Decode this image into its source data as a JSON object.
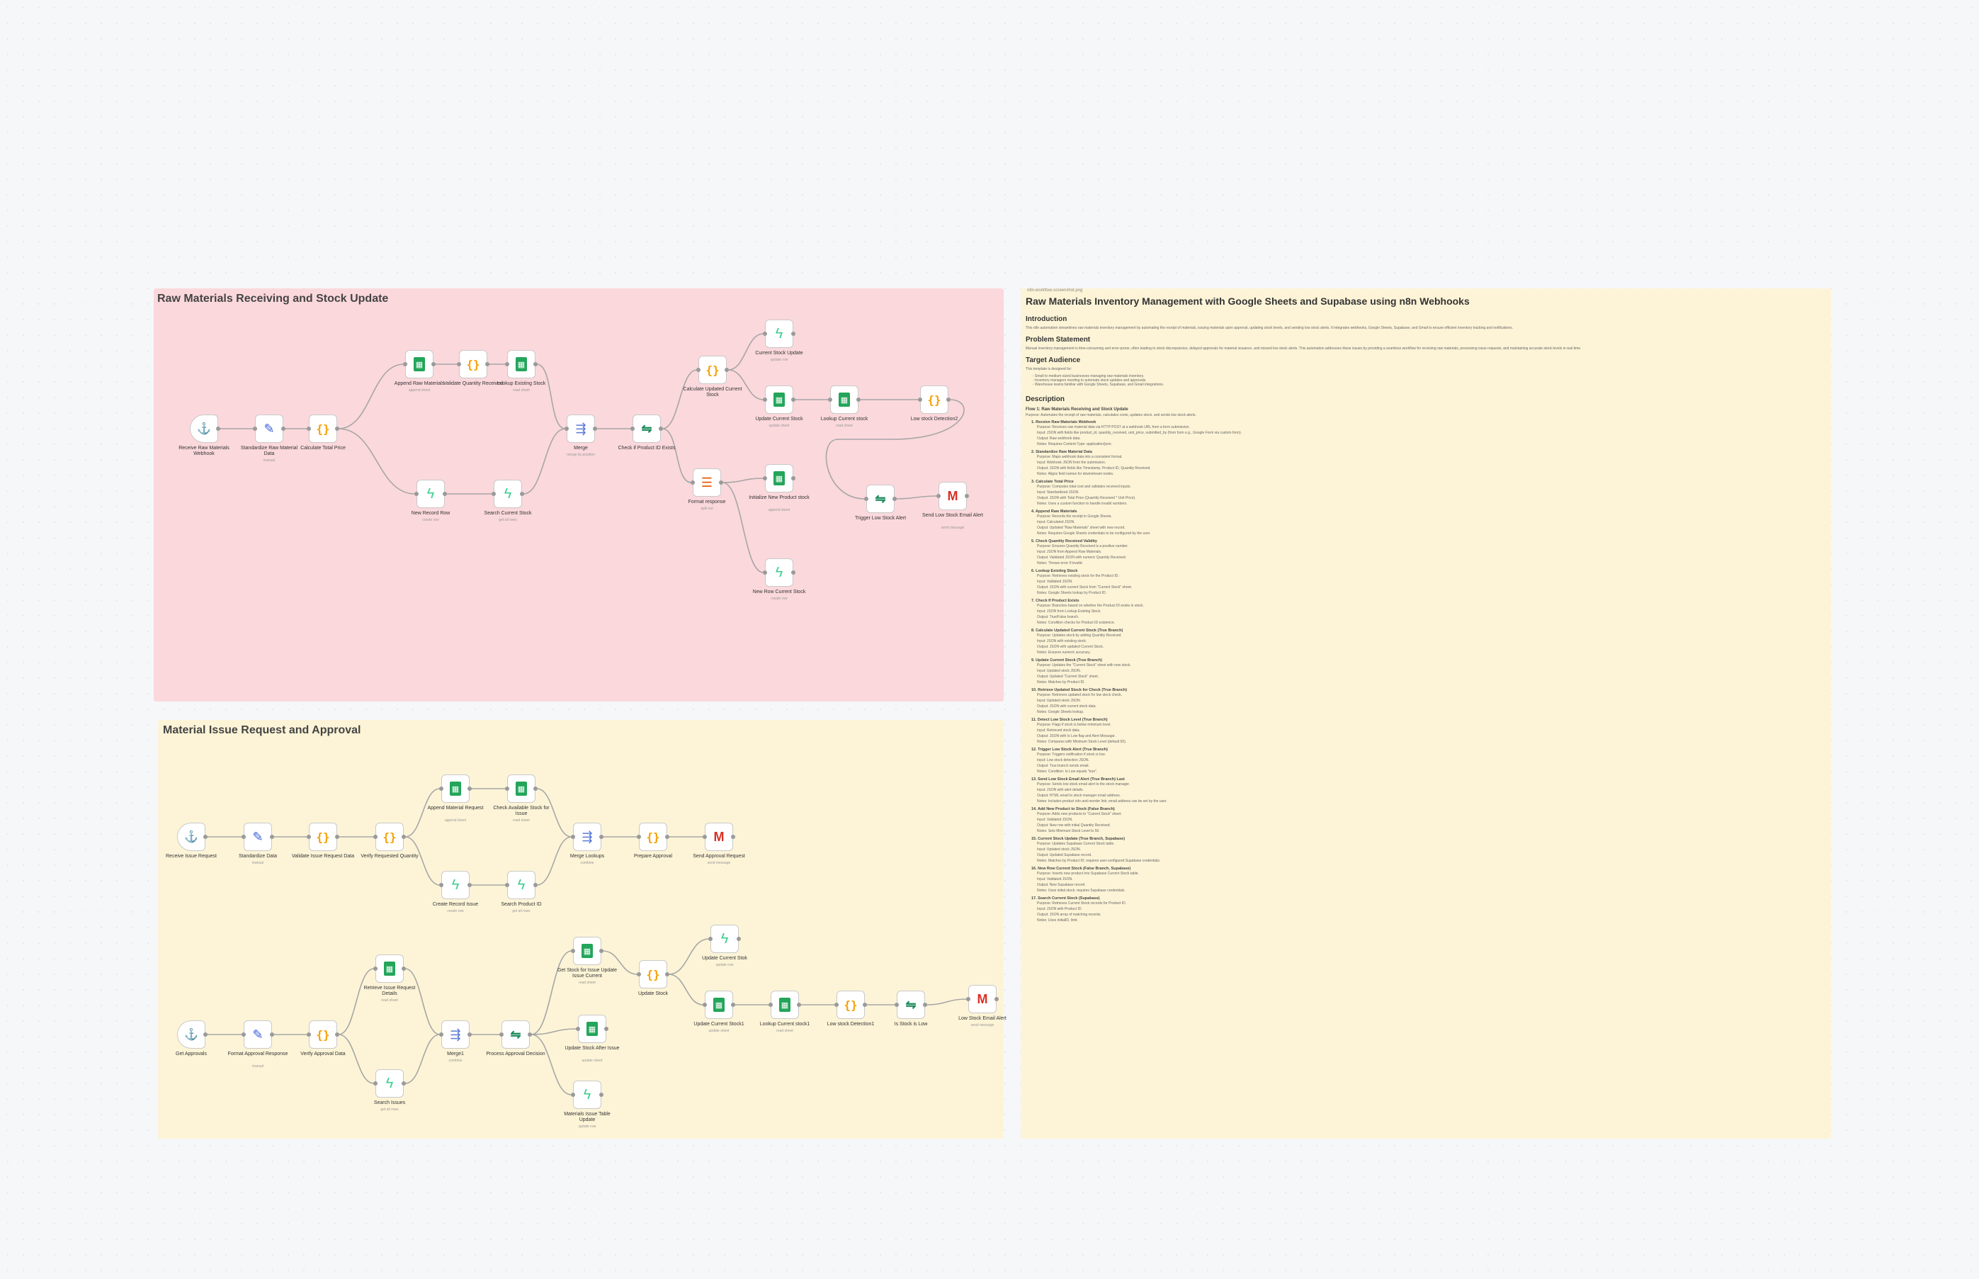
{
  "groups": {
    "receiving_title": "Raw Materials Receiving and Stock Update",
    "issue_title": "Material Issue Request and Approval"
  },
  "nodes": [
    {
      "id": "r1",
      "label": "Receive Raw Materials Webhook",
      "sub": "",
      "icon": "webhook-icon",
      "glyph": "⚓",
      "trigger": true
    },
    {
      "id": "r2",
      "label": "Standardize Raw Material Data",
      "sub": "manual",
      "icon": "pencil-icon",
      "glyph": "✎"
    },
    {
      "id": "r3",
      "label": "Calculate Total Price",
      "sub": "",
      "icon": "code-braces-icon",
      "glyph": "{}"
    },
    {
      "id": "r4",
      "label": "Append Raw Materials",
      "sub": "append sheet",
      "icon": "google-sheets-icon",
      "glyph": "▦"
    },
    {
      "id": "r5",
      "label": "Validate Quantity Received",
      "sub": "",
      "icon": "code-braces-icon",
      "glyph": "{}"
    },
    {
      "id": "r6",
      "label": "Lookup Existing Stock",
      "sub": "read sheet",
      "icon": "google-sheets-icon",
      "glyph": "▦"
    },
    {
      "id": "r7",
      "label": "New Record Row",
      "sub": "create row",
      "icon": "supabase-icon",
      "glyph": "ϟ"
    },
    {
      "id": "r8",
      "label": "Search Current Stock",
      "sub": "get all rows",
      "icon": "supabase-icon",
      "glyph": "ϟ"
    },
    {
      "id": "r9",
      "label": "Merge",
      "sub": "merge by position",
      "icon": "merge-icon",
      "glyph": "⇶"
    },
    {
      "id": "r10",
      "label": "Check if Product ID Exists",
      "sub": "",
      "icon": "if-icon",
      "glyph": "⇋"
    },
    {
      "id": "r11",
      "label": "Calculate Updated Current Stock",
      "sub": "",
      "icon": "code-braces-icon",
      "glyph": "{}"
    },
    {
      "id": "r12",
      "label": "Current Stock Update",
      "sub": "update row",
      "icon": "supabase-icon",
      "glyph": "ϟ"
    },
    {
      "id": "r13",
      "label": "Update Current Stock",
      "sub": "update sheet",
      "icon": "google-sheets-icon",
      "glyph": "▦"
    },
    {
      "id": "r14",
      "label": "Lookup Current stock",
      "sub": "read sheet",
      "icon": "google-sheets-icon",
      "glyph": "▦"
    },
    {
      "id": "r15",
      "label": "Low stock Detection2",
      "sub": "",
      "icon": "code-braces-icon",
      "glyph": "{}"
    },
    {
      "id": "r16",
      "label": "Format response",
      "sub": "split out",
      "icon": "list-icon",
      "glyph": "☰"
    },
    {
      "id": "r17",
      "label": "Initialize New Product stock",
      "sub": "append sheet",
      "icon": "google-sheets-icon",
      "glyph": "▦"
    },
    {
      "id": "r18",
      "label": "Trigger Low Stock Alert",
      "sub": "",
      "icon": "if-icon",
      "glyph": "⇋"
    },
    {
      "id": "r19",
      "label": "Send Low Stock Email Alert",
      "sub": "send message",
      "icon": "gmail-icon",
      "glyph": "M"
    },
    {
      "id": "r20",
      "label": "New Row Current Stock",
      "sub": "create row",
      "icon": "supabase-icon",
      "glyph": "ϟ"
    },
    {
      "id": "a1",
      "label": "Receive Issue Request",
      "sub": "",
      "icon": "webhook-icon",
      "glyph": "⚓",
      "trigger": true
    },
    {
      "id": "a2",
      "label": "Standardize Data",
      "sub": "manual",
      "icon": "pencil-icon",
      "glyph": "✎"
    },
    {
      "id": "a3",
      "label": "Validate Issue Request Data",
      "sub": "",
      "icon": "code-braces-icon",
      "glyph": "{}"
    },
    {
      "id": "a4",
      "label": "Verify Requested Quantity",
      "sub": "",
      "icon": "code-braces-icon",
      "glyph": "{}"
    },
    {
      "id": "a5",
      "label": "Append Material Request",
      "sub": "append sheet",
      "icon": "google-sheets-icon",
      "glyph": "▦"
    },
    {
      "id": "a6",
      "label": "Check Available Stock for Issue",
      "sub": "read sheet",
      "icon": "google-sheets-icon",
      "glyph": "▦"
    },
    {
      "id": "a7",
      "label": "Create Record Issue",
      "sub": "create row",
      "icon": "supabase-icon",
      "glyph": "ϟ"
    },
    {
      "id": "a8",
      "label": "Search Product ID",
      "sub": "get all rows",
      "icon": "supabase-icon",
      "glyph": "ϟ"
    },
    {
      "id": "a9",
      "label": "Merge Lookups",
      "sub": "combine",
      "icon": "merge-icon",
      "glyph": "⇶"
    },
    {
      "id": "a10",
      "label": "Prepare Approval",
      "sub": "",
      "icon": "code-braces-icon",
      "glyph": "{}"
    },
    {
      "id": "a11",
      "label": "Send Approval Request",
      "sub": "send message",
      "icon": "gmail-icon",
      "glyph": "M"
    },
    {
      "id": "b1",
      "label": "Get Approvals",
      "sub": "",
      "icon": "webhook-icon",
      "glyph": "⚓",
      "trigger": true
    },
    {
      "id": "b2",
      "label": "Format Approval Response",
      "sub": "manual",
      "icon": "pencil-icon",
      "glyph": "✎"
    },
    {
      "id": "b3",
      "label": "Verify Approval Data",
      "sub": "",
      "icon": "code-braces-icon",
      "glyph": "{}"
    },
    {
      "id": "b4",
      "label": "Retrieve Issue Request Details",
      "sub": "read sheet",
      "icon": "google-sheets-icon",
      "glyph": "▦"
    },
    {
      "id": "b5",
      "label": "Search Issues",
      "sub": "get all rows",
      "icon": "supabase-icon",
      "glyph": "ϟ"
    },
    {
      "id": "b6",
      "label": "Merge1",
      "sub": "combine",
      "icon": "merge-icon",
      "glyph": "⇶"
    },
    {
      "id": "b7",
      "label": "Process Approval Decision",
      "sub": "",
      "icon": "if-icon",
      "glyph": "⇋"
    },
    {
      "id": "b8",
      "label": "Get Stock for Issue Update Issue Current",
      "sub": "read sheet",
      "icon": "google-sheets-icon",
      "glyph": "▦"
    },
    {
      "id": "b9",
      "label": "Update Stock",
      "sub": "",
      "icon": "code-braces-icon",
      "glyph": "{}"
    },
    {
      "id": "b10",
      "label": "Update Current Stok",
      "sub": "update row",
      "icon": "supabase-icon",
      "glyph": "ϟ"
    },
    {
      "id": "b11",
      "label": "Update Current Stock1",
      "sub": "update sheet",
      "icon": "google-sheets-icon",
      "glyph": "▦"
    },
    {
      "id": "b12",
      "label": "Lookup Current stock1",
      "sub": "read sheet",
      "icon": "google-sheets-icon",
      "glyph": "▦"
    },
    {
      "id": "b13",
      "label": "Low stock Detection1",
      "sub": "",
      "icon": "code-braces-icon",
      "glyph": "{}"
    },
    {
      "id": "b14",
      "label": "Is Stock is Low",
      "sub": "",
      "icon": "if-icon",
      "glyph": "⇋"
    },
    {
      "id": "b15",
      "label": "Low Stock Email Alert",
      "sub": "send message",
      "icon": "gmail-icon",
      "glyph": "M"
    },
    {
      "id": "b16",
      "label": "Update Stock After Issue",
      "sub": "update sheet",
      "icon": "google-sheets-icon",
      "glyph": "▦"
    },
    {
      "id": "b17",
      "label": "Materials Issue Table Update",
      "sub": "update row",
      "icon": "supabase-icon",
      "glyph": "ϟ"
    }
  ],
  "doc": {
    "image_caption": "n8n-workflow-screenshot.png",
    "title": "Raw Materials Inventory Management with Google Sheets and Supabase using n8n Webhooks",
    "intro_heading": "Introduction",
    "intro_text": "This n8n automation streamlines raw materials inventory management by automating the receipt of materials, issuing materials upon approval, updating stock levels, and sending low stock alerts. It integrates webhooks, Google Sheets, Supabase, and Gmail to ensure efficient inventory tracking and notifications.",
    "problem_heading": "Problem Statement",
    "problem_text": "Manual inventory management is time-consuming and error-prone, often leading to stock discrepancies, delayed approvals for material issuance, and missed low stock alerts. This automation addresses these issues by providing a seamless workflow for receiving raw materials, processing issue requests, and maintaining accurate stock levels in real time.",
    "audience_heading": "Target Audience",
    "audience_intro": "This template is designed for:",
    "audience_items": [
      "- Small to medium-sized businesses managing raw materials inventory.",
      "- Inventory managers needing to automate stock updates and approvals.",
      "- Warehouse teams familiar with Google Sheets, Supabase, and Gmail integrations."
    ],
    "desc_heading": "Description",
    "flow_title": "Flow 1: Raw Materials Receiving and Stock Update",
    "flow_purpose": "Purpose: Automates the receipt of raw materials, calculates costs, updates stock, and sends low stock alerts.",
    "steps": [
      {
        "t": "1. Receive Raw Materials Webhook",
        "l": [
          "Purpose: Receives raw material data via HTTP POST at a webhook URL from a form submission.",
          "Input: JSON with fields like product_id, quantity_received, unit_price, submitted_by (from form e.g., Google Form via custom form).",
          "Output: Raw webhook data.",
          "Notes: Requires Content-Type: application/json."
        ]
      },
      {
        "t": "2. Standardize Raw Material Data",
        "l": [
          "Purpose: Maps webhook data into a consistent format.",
          "Input: Webhook JSON from the submission.",
          "Output: JSON with fields like Timestamp, Product ID, Quantity Received.",
          "Notes: Aligns field names for downstream nodes."
        ]
      },
      {
        "t": "3. Calculate Total Price",
        "l": [
          "Purpose: Computes total cost and validates received inputs.",
          "Input: Standardized JSON.",
          "Output: JSON with Total Price (Quantity Received * Unit Price).",
          "Notes: Uses a custom function to handle invalid numbers."
        ]
      },
      {
        "t": "4. Append Raw Materials",
        "l": [
          "Purpose: Records the receipt in Google Sheets.",
          "Input: Calculated JSON.",
          "Output: Updated \"Raw Materials\" sheet with new record.",
          "Notes: Requires Google Sheets credentials to be configured by the user."
        ]
      },
      {
        "t": "5. Check Quantity Received Validity",
        "l": [
          "Purpose: Ensures Quantity Received is a positive number.",
          "Input: JSON from Append Raw Materials.",
          "Output: Validated JSON with numeric Quantity Received.",
          "Notes: Throws error if invalid."
        ]
      },
      {
        "t": "6. Lookup Existing Stock",
        "l": [
          "Purpose: Retrieves existing stock for the Product ID.",
          "Input: Validated JSON.",
          "Output: JSON with current Stock from \"Current Stock\" sheet.",
          "Notes: Google Sheets lookup by Product ID."
        ]
      },
      {
        "t": "7. Check If Product Exists",
        "l": [
          "Purpose: Branches based on whether the Product ID exists in stock.",
          "Input: JSON from Lookup Existing Stock.",
          "Output: True/False branch.",
          "Notes: Condition checks for Product ID existence."
        ]
      },
      {
        "t": "8. Calculate Updated Current Stock (True Branch)",
        "l": [
          "Purpose: Updates stock by adding Quantity Received.",
          "Input: JSON with existing stock.",
          "Output: JSON with updated Current Stock.",
          "Notes: Ensures numeric accuracy."
        ]
      },
      {
        "t": "9. Update Current Stock (True Branch)",
        "l": [
          "Purpose: Updates the \"Current Stock\" sheet with new stock.",
          "Input: Updated stock JSON.",
          "Output: Updated \"Current Stock\" sheet.",
          "Notes: Matches by Product ID."
        ]
      },
      {
        "t": "10. Retrieve Updated Stock for Check (True Branch)",
        "l": [
          "Purpose: Retrieves updated stock for low stock check.",
          "Input: Updated stock JSON.",
          "Output: JSON with current stock data.",
          "Notes: Google Sheets lookup."
        ]
      },
      {
        "t": "11. Detect Low Stock Level (True Branch)",
        "l": [
          "Purpose: Flags if stock is below minimum level.",
          "Input: Retrieved stock data.",
          "Output: JSON with Is Low flag and Alert Message.",
          "Notes: Compares with Minimum Stock Level (default 50)."
        ]
      },
      {
        "t": "12. Trigger Low Stock Alert (True Branch)",
        "l": [
          "Purpose: Triggers notification if stock is low.",
          "Input: Low stock detection JSON.",
          "Output: True branch sends email.",
          "Notes: Condition: Is Low equals \"true\"."
        ]
      },
      {
        "t": "13. Send Low Stock Email Alert (True Branch) Last",
        "l": [
          "Purpose: Sends low stock email alert to the stock manager.",
          "Input: JSON with alert details.",
          "Output: HTML email to stock manager email address.",
          "Notes: Includes product info and reorder link; email address can be set by the user."
        ]
      },
      {
        "t": "14. Add New Product to Stock (False Branch)",
        "l": [
          "Purpose: Adds new products to \"Current Stock\" sheet.",
          "Input: Validated JSON.",
          "Output: New row with initial Quantity Received.",
          "Notes: Sets Minimum Stock Level to 50."
        ]
      },
      {
        "t": "15. Current Stock Update (True Branch, Supabase)",
        "l": [
          "Purpose: Updates Supabase Current Stock table.",
          "Input: Updated stock JSON.",
          "Output: Updated Supabase record.",
          "Notes: Matches by Product ID; requires user-configured Supabase credentials."
        ]
      },
      {
        "t": "16. New Row Current Stock (False Branch, Supabase)",
        "l": [
          "Purpose: Inserts new product into Supabase Current Stock table.",
          "Input: Validated JSON.",
          "Output: New Supabase record.",
          "Notes: Uses initial stock; requires Supabase credentials."
        ]
      },
      {
        "t": "17. Search Current Stock (Supabase)",
        "l": [
          "Purpose: Retrieves Current Stock records for Product ID.",
          "Input: JSON with Product ID.",
          "Output: JSON array of matching records.",
          "Notes: Uses initialID, limit."
        ]
      }
    ]
  }
}
